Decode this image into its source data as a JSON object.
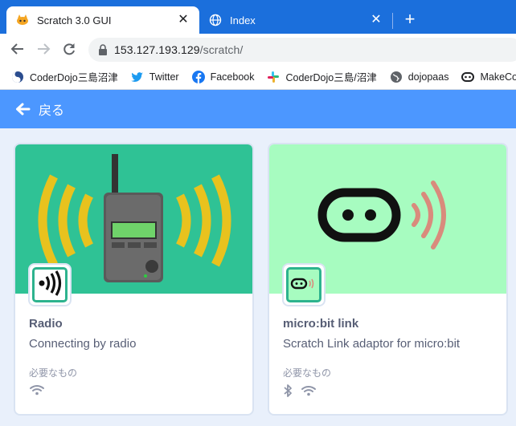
{
  "tabs": [
    {
      "title": "Scratch 3.0 GUI",
      "active": true,
      "icon": "scratch-cat-icon"
    },
    {
      "title": "Index",
      "active": false,
      "icon": "globe-icon"
    }
  ],
  "toolbar": {
    "url_host": "153.127.193.129",
    "url_path": "/scratch/"
  },
  "bookmarks": [
    {
      "label": "CoderDojo三島沼津",
      "icon": "coderdojo-icon"
    },
    {
      "label": "Twitter",
      "icon": "twitter-icon"
    },
    {
      "label": "Facebook",
      "icon": "facebook-icon"
    },
    {
      "label": "CoderDojo三島/沼津",
      "icon": "slack-icon"
    },
    {
      "label": "dojopaas",
      "icon": "globe-icon"
    },
    {
      "label": "MakeCod",
      "icon": "makecode-icon"
    }
  ],
  "header": {
    "back_label": "戻る"
  },
  "extensions": [
    {
      "name": "Radio",
      "description": "Connecting by radio",
      "requirements_label": "必要なもの",
      "requirements": [
        "wifi-icon"
      ],
      "hero_color": "#2fc295"
    },
    {
      "name": "micro:bit link",
      "description": "Scratch Link adaptor for micro:bit",
      "requirements_label": "必要なもの",
      "requirements": [
        "bluetooth-icon",
        "wifi-icon"
      ],
      "hero_color": "#a7fcc0"
    }
  ],
  "colors": {
    "browser_blue": "#1b6fdc",
    "scratch_blue": "#4c97ff",
    "text": "#575e75",
    "badge_border": "#2db38e"
  }
}
